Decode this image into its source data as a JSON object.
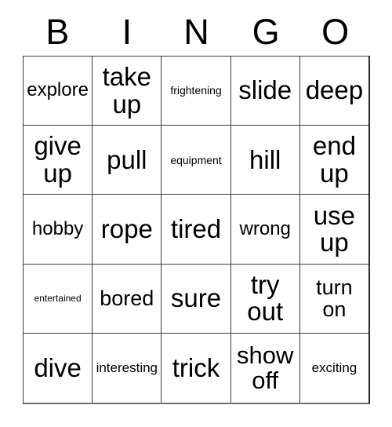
{
  "card": {
    "title": "Bingo Card",
    "header_letters": [
      "B",
      "I",
      "N",
      "G",
      "O"
    ],
    "colors": {
      "background": "#ffffff",
      "text": "#000000",
      "grid_line": "#3a3a3a",
      "outer_border": "#2b2b2b"
    },
    "grid": {
      "rows": 5,
      "columns": 5,
      "cells": [
        [
          {
            "text": "explore",
            "size": "size-sm"
          },
          {
            "text": "take up",
            "size": "size-xl"
          },
          {
            "text": "frightening",
            "size": "size-tiny"
          },
          {
            "text": "slide",
            "size": "size-xl"
          },
          {
            "text": "deep",
            "size": "size-xl"
          }
        ],
        [
          {
            "text": "give up",
            "size": "size-xl"
          },
          {
            "text": "pull",
            "size": "size-xl"
          },
          {
            "text": "equipment",
            "size": "size-tiny"
          },
          {
            "text": "hill",
            "size": "size-xl"
          },
          {
            "text": "end up",
            "size": "size-xl"
          }
        ],
        [
          {
            "text": "hobby",
            "size": "size-sm"
          },
          {
            "text": "rope",
            "size": "size-xl"
          },
          {
            "text": "tired",
            "size": "size-xl"
          },
          {
            "text": "wrong",
            "size": "size-sm"
          },
          {
            "text": "use up",
            "size": "size-xl"
          }
        ],
        [
          {
            "text": "entertained",
            "size": "size-mini"
          },
          {
            "text": "bored",
            "size": "size-md"
          },
          {
            "text": "sure",
            "size": "size-xl"
          },
          {
            "text": "try out",
            "size": "size-xl"
          },
          {
            "text": "turn on",
            "size": "size-md"
          }
        ],
        [
          {
            "text": "dive",
            "size": "size-xl"
          },
          {
            "text": "interesting",
            "size": "size-xxs"
          },
          {
            "text": "trick",
            "size": "size-xl"
          },
          {
            "text": "show off",
            "size": "size-lg"
          },
          {
            "text": "exciting",
            "size": "size-xxs"
          }
        ]
      ]
    }
  }
}
